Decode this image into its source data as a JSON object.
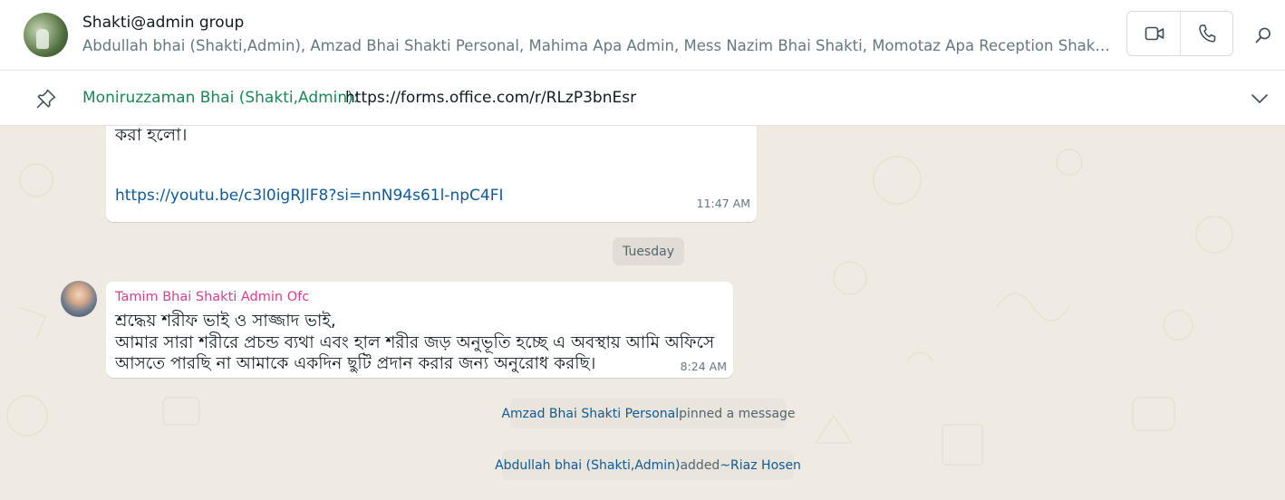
{
  "header": {
    "group_name": "Shakti@admin group",
    "members": "Abdullah bhai (Shakti,Admin), Amzad Bhai Shakti Personal, Mahima Apa Admin, Mess Nazim Bhai Shakti, Momotaz Apa Reception Shakti, Moniruzzaman Bhai (Shakti,Admin), Tamim Bhai Shakti Admin Ofc",
    "icons": [
      "video-call-icon",
      "voice-call-icon",
      "search-icon"
    ]
  },
  "pinned": {
    "author": "Moniruzzaman Bhai (Shakti,Admin):",
    "text": "https://forms.office.com/r/RLzP3bnEsr",
    "icons": [
      "pin-icon",
      "chevron-down-icon"
    ]
  },
  "messages": [
    {
      "text_tail": "করা হলো।",
      "link": "https://youtu.be/c3l0igRJlF8?si=nnN94s61l-npC4FI",
      "time": "11:47 AM"
    }
  ],
  "date_divider": "Tuesday",
  "message2": {
    "sender": "Tamim Bhai Shakti Admin Ofc",
    "line1": "শ্রদ্ধেয় শরীফ ভাই ও সাজ্জাদ ভাই,",
    "line2": "আমার সারা শরীরে প্রচন্ড ব্যথা এবং হাল শরীর জড় অনুভূতি হচ্ছে এ অবস্থায় আমি অফিসে",
    "line3": "আসতে পারছি না আমাকে একদিন ছুটি প্রদান করার জন্য  অনুরোধ করছি।",
    "time": "8:24 AM"
  },
  "system1": {
    "name": "Amzad Bhai Shakti Personal",
    "action": "pinned a message"
  },
  "system2": {
    "actor": "Abdullah bhai (Shakti,Admin)",
    "action": "added",
    "target": "~Riaz Hosen"
  },
  "colors": {
    "accent_green": "#1b8755",
    "sender_pink": "#d43f8d",
    "link_blue": "#0f5a96",
    "chat_background": "#efeae2"
  }
}
